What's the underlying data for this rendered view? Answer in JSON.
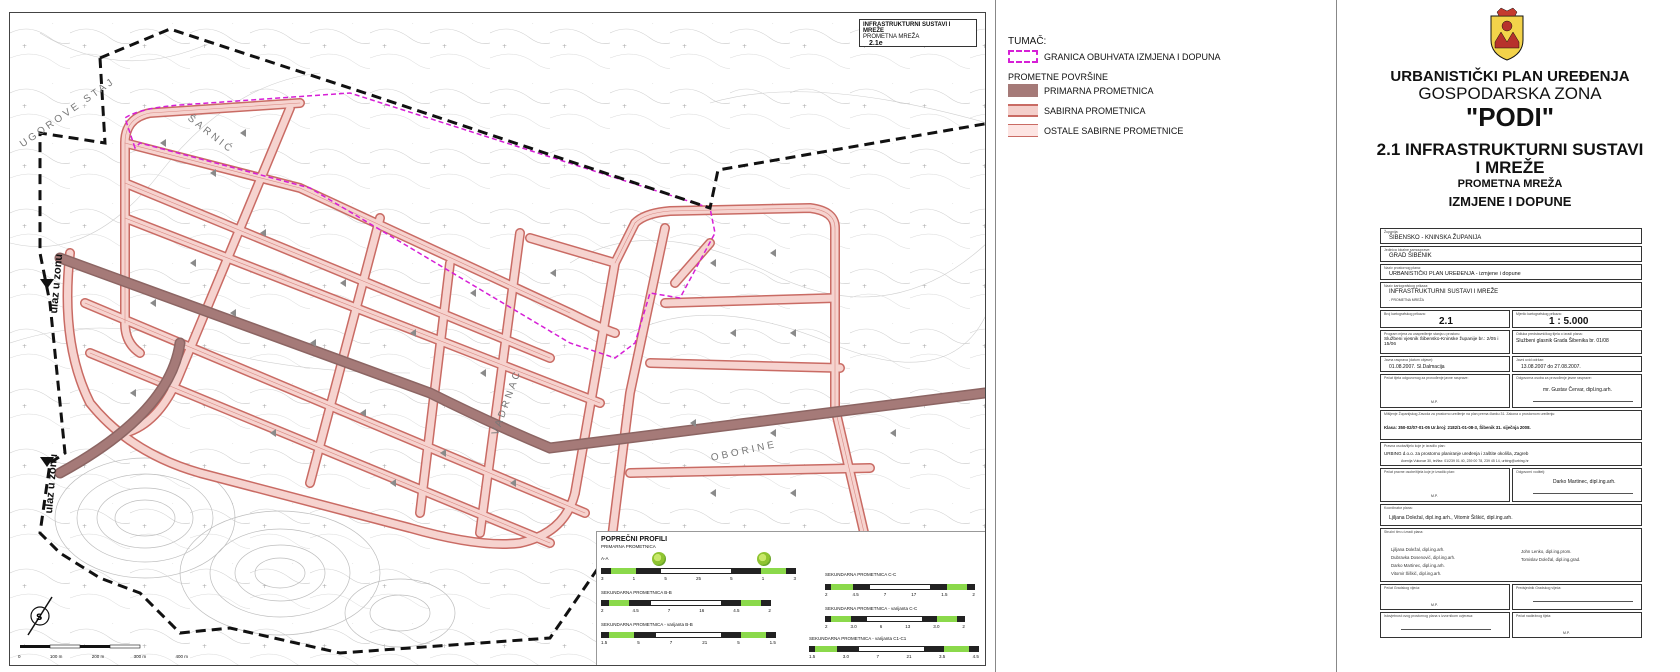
{
  "map": {
    "title_box": {
      "title": "INFRASTRUKTURNI SUSTAVI I MREŽE",
      "subtitle": "PROMETNA MREŽA",
      "sheet": "2.1e"
    },
    "entry_labels": [
      "ulaz u zonu",
      "ulaz u zonu"
    ],
    "place_labels": [
      "UGOROVE STAJ",
      "ŠARNIĆ",
      "VADRNAC",
      "OBORINE"
    ],
    "scale_bar": [
      "0",
      "100 m",
      "200 m",
      "300 m",
      "400 m"
    ]
  },
  "profiles": {
    "heading": "POPREČNI PROFILI",
    "subheading": "PRIMARNA PROMETNICA",
    "items": [
      {
        "name": "A-A",
        "dims": [
          "3",
          "1",
          "5",
          "25",
          "5",
          "1",
          "3"
        ]
      },
      {
        "name": "SEKUNDARNA PROMETNICA B-B",
        "dims": [
          "2",
          "4.5",
          "7",
          "16",
          "4.5",
          "2"
        ]
      },
      {
        "name": "SEKUNDARNA PROMETNICA - varijanta B-B",
        "dims": [
          "1.5",
          "5",
          "7",
          "21",
          "5",
          "1.5"
        ]
      },
      {
        "name": "SEKUNDARNA PROMETNICA C-C",
        "dims": [
          "2",
          "4.5",
          "7",
          "17",
          "1.5",
          "2"
        ]
      },
      {
        "name": "SEKUNDARNA PROMETNICA - varijanta C-C",
        "dims": [
          "2",
          "3.0",
          "6",
          "13",
          "3.0",
          "2"
        ]
      },
      {
        "name": "SEKUNDARNA PROMETNICA - varijanta C1-C1",
        "dims": [
          "1.5",
          "3.0",
          "7",
          "21",
          "3.5",
          "4.5"
        ]
      }
    ]
  },
  "legend": {
    "title": "TUMAČ:",
    "boundary": "GRANICA OBUHVATA IZMJENA I DOPUNA",
    "section": "PROMETNE POVRŠINE",
    "items": [
      "PRIMARNA PROMETNICA",
      "SABIRNA PROMETNICA",
      "OSTALE SABIRNE PROMETNICE"
    ],
    "colors": {
      "boundary": "#d61fd6",
      "primary": "#a57a78",
      "secondary": "#f4cfcb",
      "road_edge": "#c96b64"
    }
  },
  "title_block": {
    "line1": "URBANISTIČKI PLAN UREĐENJA",
    "line2": "GOSPODARSKA ZONA",
    "line3": "\"PODI\"",
    "line4": "2.1 INFRASTRUKTURNI SUSTAVI",
    "line5": "I MREŽE",
    "line6": "PROMETNA MREŽA",
    "line7": "IZMJENE I DOPUNE"
  },
  "form": {
    "zupanija": "ŠIBENSKO - KNINSKA ŽUPANIJA",
    "grad": "GRAD ŠIBENIK",
    "plan": "URBANISTIČKI PLAN UREĐENJA - izmjene i dopune",
    "karta": "INFRASTRUKTURNI SUSTAVI I MREŽE",
    "karta_sub": "- PROMETNA MREŽA",
    "broj": "2.1",
    "mjerilo": "1 : 5.000",
    "glasnik_left": "Službeni vjesnik Šibensko-Kninske županije br.: 2/05 i 15/06",
    "glasnik_right": "Službeni glasnik Grada Šibenika br. 01/08",
    "uvid_left": "01.08.2007. Sl.Dalmacija",
    "uvid_right": "13.08.2007 do 27.08.2007.",
    "odgovorna_osoba": "mr. Gustav Červar, dipl.ing.arh.",
    "klasa": "Klasa: 350-02/07-01-05 Ur.broj: 2182/1-01-08-3, Šibenik 31. siječnja 2008.",
    "izradivac": "URBING d.o.o. za prostorno planiranje uređenja i zaštite okoliša, Zagreb",
    "izradivac_addr": "Avenija Vukovar 30, tel/fax: 01/239 01 40, 239 00 78, 239 45 14, urbing@urbing.hr",
    "voditelj": "Darko Martinec, dipl.ing.arh.",
    "koordinatori": "Ljiljana Doležal, dipl.ing.arh., Vitomir Šiškić, dipl.ing.arh.",
    "tim_left": [
      "Ljiljana Doležal, dipl.ing.arh.",
      "Dubravka Dosenović, dipl.ing.arh.",
      "Darko Martinec, dipl.ing.arh.",
      "Vitomir Šiškić, dipl.ing.arh."
    ],
    "tim_right": [
      "John Lenko, dipl.ing.prom.",
      "Tomislav Doležal, dipl.ing.grad."
    ],
    "mp": "M.P."
  }
}
